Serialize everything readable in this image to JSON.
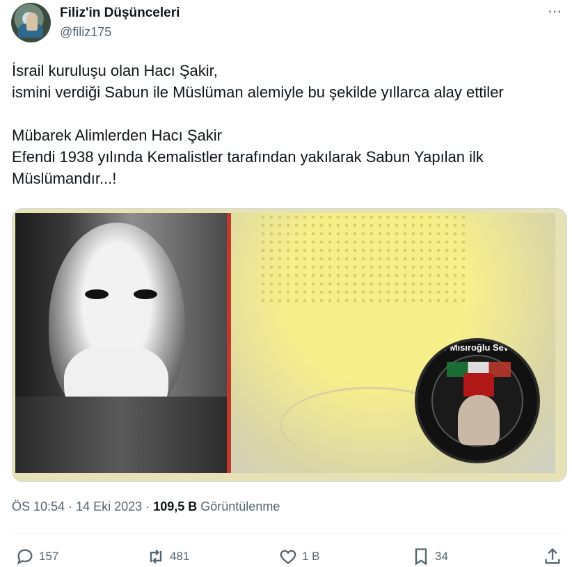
{
  "author": {
    "name": "Filiz'in Düşünceleri",
    "handle": "@filiz175"
  },
  "more_icon": "⋯",
  "tweet": {
    "lines": [
      "İsrail kuruluşu olan Hacı Şakir,",
      "ismini verdiği Sabun ile Müslüman alemiyle bu şekilde yıllarca alay ettiler",
      "",
      "Mübarek Alimlerden Hacı Şakir",
      "Efendi 1938 yılında Kemalistler tarafından yakılarak Sabun Yapılan ilk",
      "Müslümandır...!"
    ]
  },
  "media": {
    "badge_text": "Kadir Mısıroğlu Sevenler"
  },
  "meta": {
    "time": "ÖS 10:54",
    "separator": "·",
    "date": "14 Eki 2023",
    "views_count": "109,5 B",
    "views_label": "Görüntülenme"
  },
  "actions": {
    "replies": "157",
    "reposts": "481",
    "likes": "1 B",
    "bookmarks": "34"
  }
}
